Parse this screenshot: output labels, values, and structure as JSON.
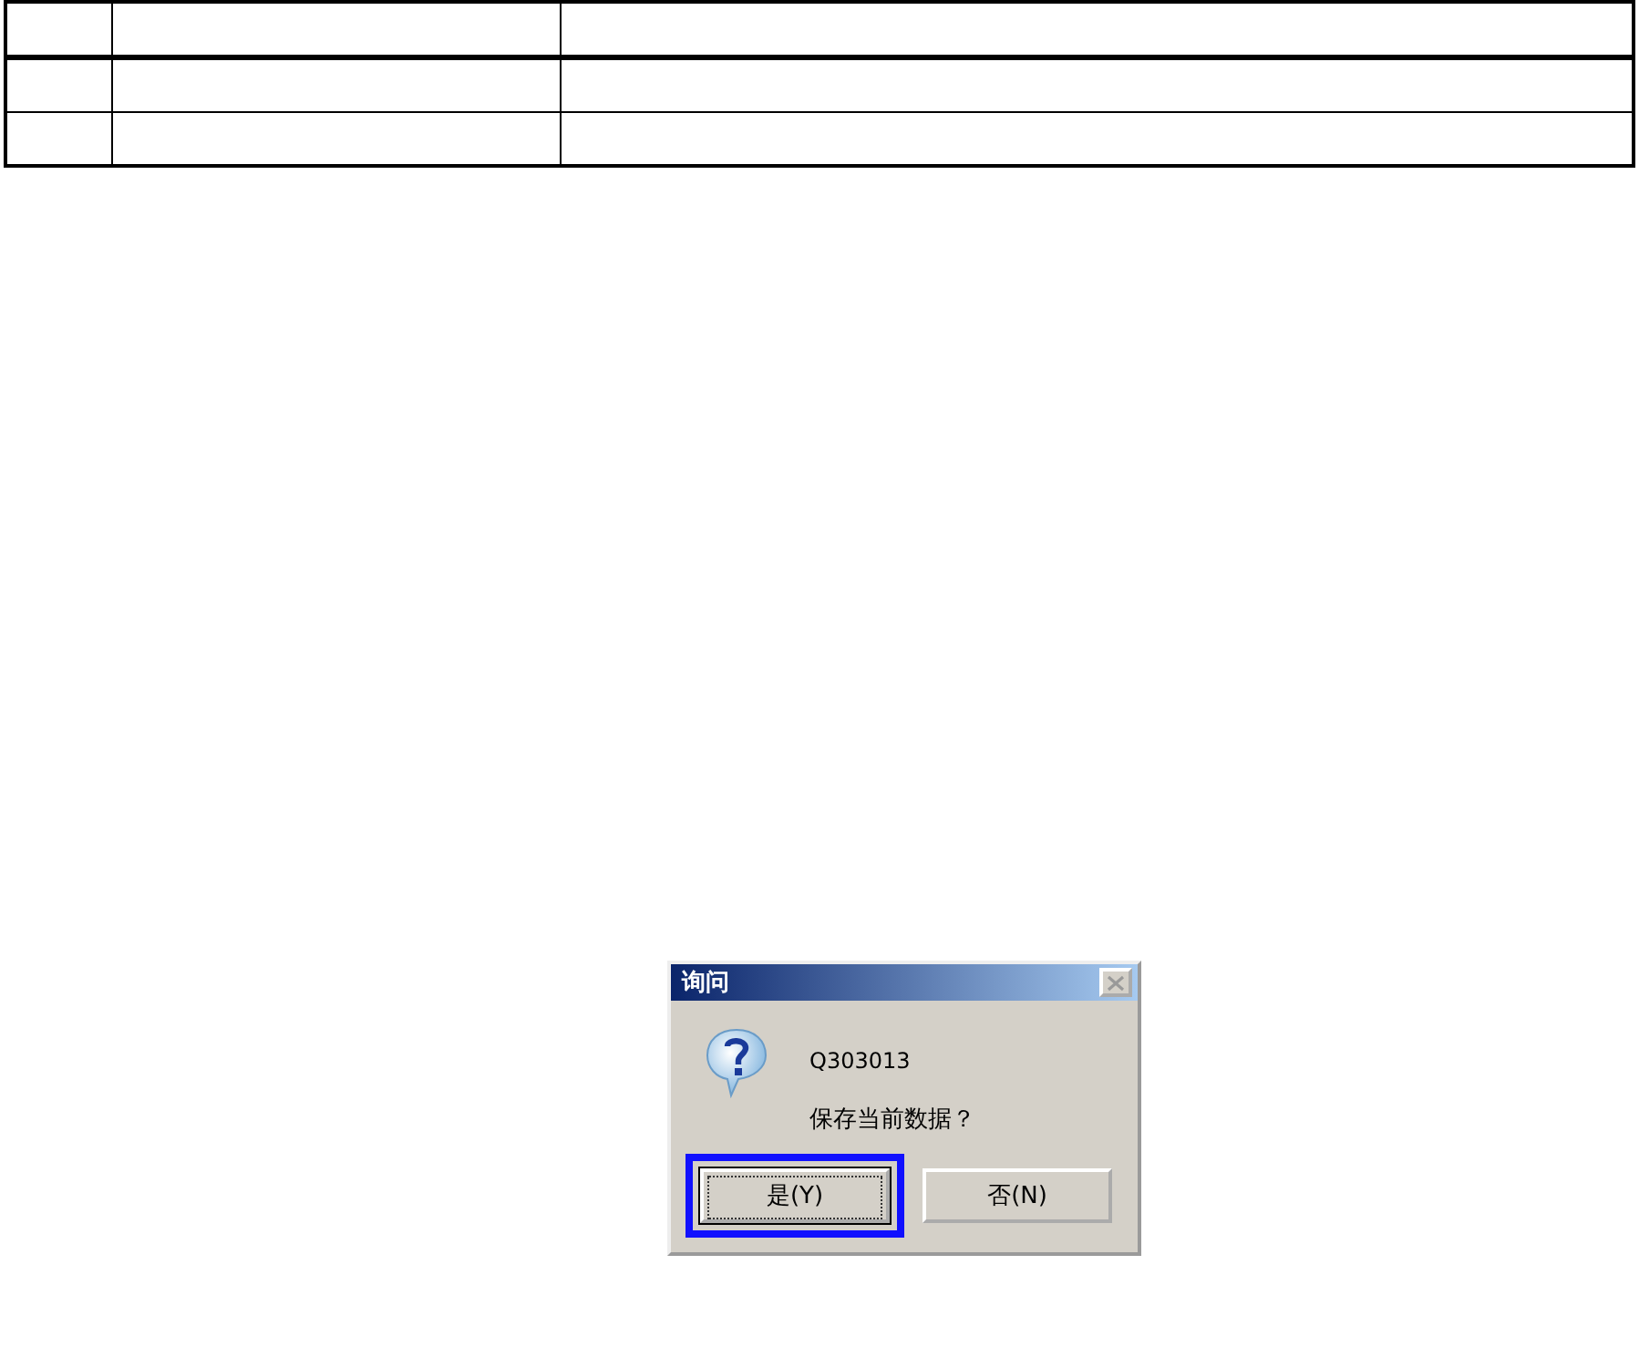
{
  "dialog": {
    "title": "询问",
    "code": "Q303013",
    "message": "保存当前数据？",
    "buttons": [
      {
        "label": "是(Y)",
        "focused": true,
        "highlighted": true
      },
      {
        "label": "否(N)",
        "focused": false,
        "highlighted": false
      }
    ]
  }
}
